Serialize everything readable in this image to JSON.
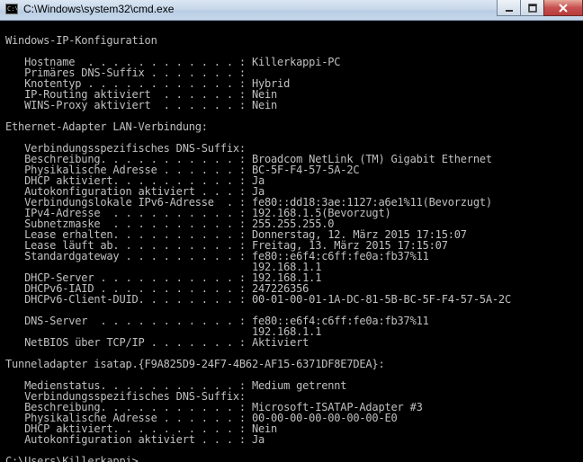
{
  "window": {
    "title": "C:\\Windows\\system32\\cmd.exe",
    "icon_text": "C:\\",
    "icon_name": "cmd-app-icon",
    "buttons": [
      "minimize",
      "maximize",
      "close"
    ]
  },
  "console": {
    "lines": [
      "",
      "Windows-IP-Konfiguration",
      "",
      "   Hostname  . . . . . . . . . . . . : Killerkappi-PC",
      "   Primäres DNS-Suffix . . . . . . . :",
      "   Knotentyp . . . . . . . . . . . . : Hybrid",
      "   IP-Routing aktiviert  . . . . . . : Nein",
      "   WINS-Proxy aktiviert  . . . . . . : Nein",
      "",
      "Ethernet-Adapter LAN-Verbindung:",
      "",
      "   Verbindungsspezifisches DNS-Suffix:",
      "   Beschreibung. . . . . . . . . . . : Broadcom NetLink (TM) Gigabit Ethernet",
      "   Physikalische Adresse . . . . . . : BC-5F-F4-57-5A-2C",
      "   DHCP aktiviert. . . . . . . . . . : Ja",
      "   Autokonfiguration aktiviert . . . : Ja",
      "   Verbindungslokale IPv6-Adresse  . : fe80::dd18:3ae:1127:a6e1%11(Bevorzugt)",
      "   IPv4-Adresse  . . . . . . . . . . : 192.168.1.5(Bevorzugt)",
      "   Subnetzmaske  . . . . . . . . . . : 255.255.255.0",
      "   Lease erhalten. . . . . . . . . . : Donnerstag, 12. März 2015 17:15:07",
      "   Lease läuft ab. . . . . . . . . . : Freitag, 13. März 2015 17:15:07",
      "   Standardgateway . . . . . . . . . : fe80::e6f4:c6ff:fe0a:fb37%11",
      "                                       192.168.1.1",
      "   DHCP-Server . . . . . . . . . . . : 192.168.1.1",
      "   DHCPv6-IAID . . . . . . . . . . . : 247226356",
      "   DHCPv6-Client-DUID. . . . . . . . : 00-01-00-01-1A-DC-81-5B-BC-5F-F4-57-5A-2C",
      "",
      "   DNS-Server  . . . . . . . . . . . : fe80::e6f4:c6ff:fe0a:fb37%11",
      "                                       192.168.1.1",
      "   NetBIOS über TCP/IP . . . . . . . : Aktiviert",
      "",
      "Tunneladapter isatap.{F9A825D9-24F7-4B62-AF15-6371DF8E7DEA}:",
      "",
      "   Medienstatus. . . . . . . . . . . : Medium getrennt",
      "   Verbindungsspezifisches DNS-Suffix:",
      "   Beschreibung. . . . . . . . . . . : Microsoft-ISATAP-Adapter #3",
      "   Physikalische Adresse . . . . . . : 00-00-00-00-00-00-00-E0",
      "   DHCP aktiviert. . . . . . . . . . : Nein",
      "   Autokonfiguration aktiviert . . . : Ja",
      "",
      "C:\\Users\\Killerkappi>"
    ]
  },
  "colors": {
    "console_background": "#000000",
    "console_text": "#c0c0c0",
    "titlebar": "#c8d8ea",
    "close_button": "#c75050"
  }
}
